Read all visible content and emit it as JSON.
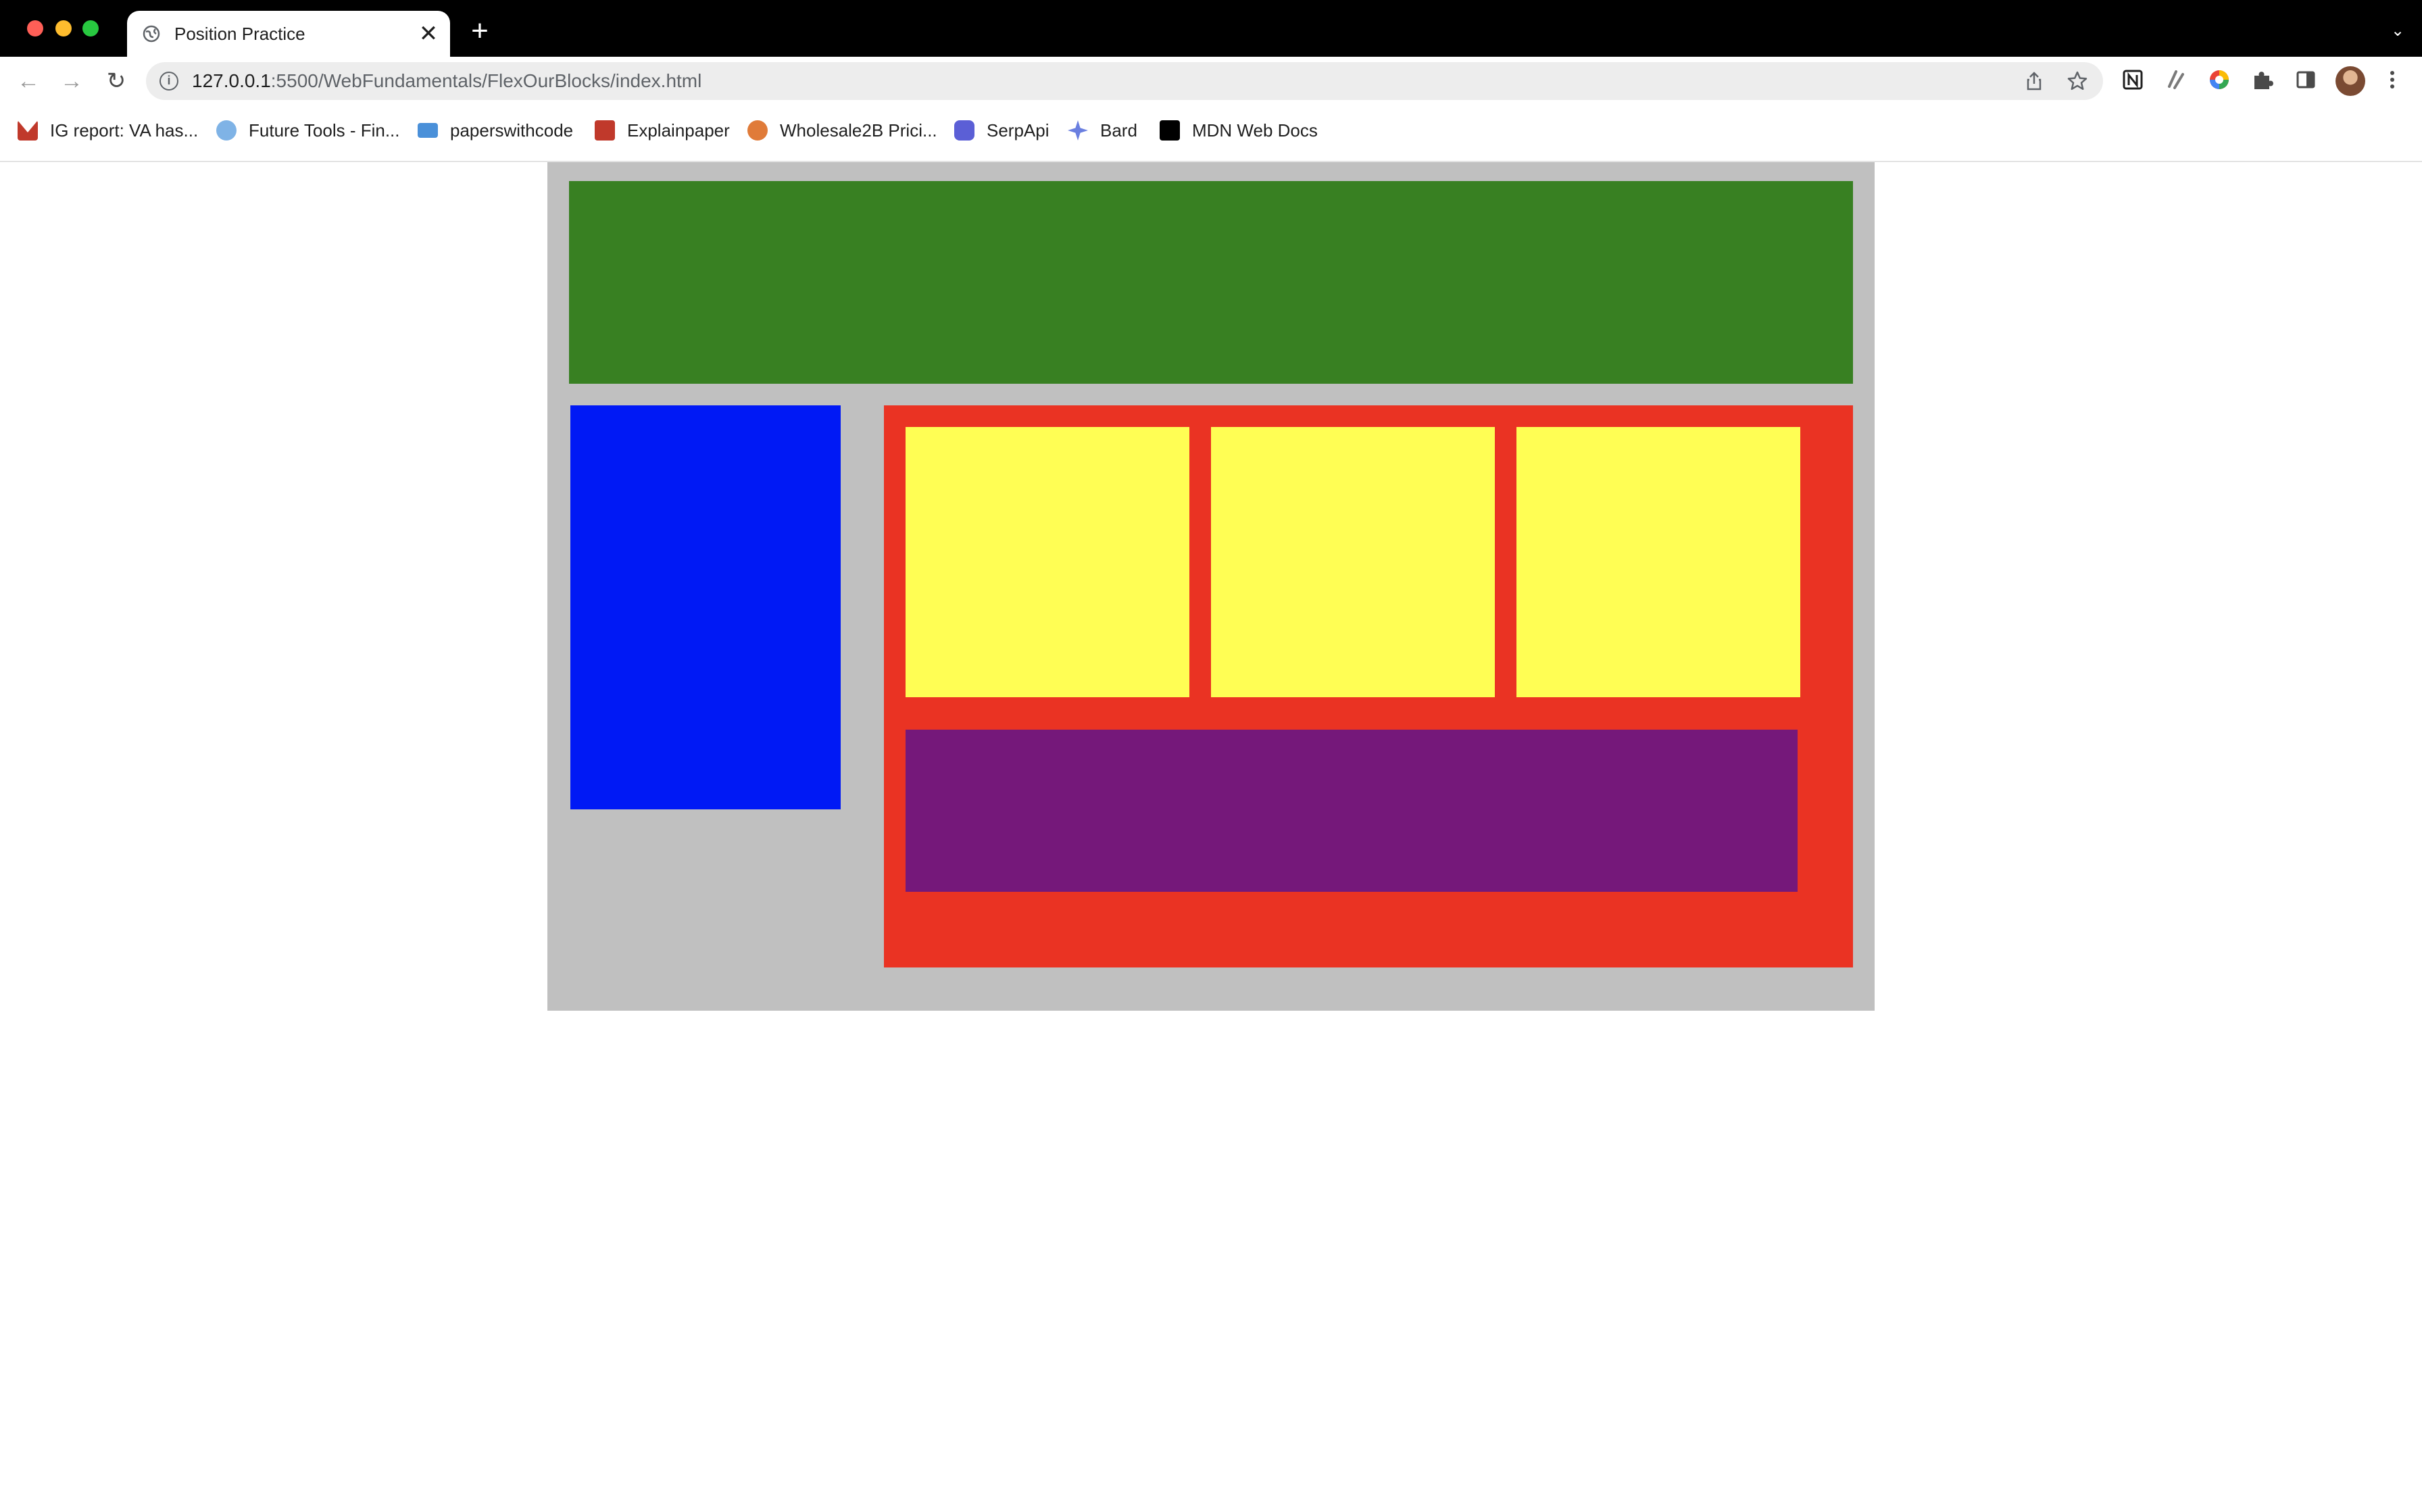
{
  "browser": {
    "tab": {
      "title": "Position Practice",
      "close": "✕"
    },
    "new_tab": "+",
    "tab_list": "⌄",
    "nav": {
      "back": "←",
      "forward": "→",
      "reload": "↻"
    },
    "address": {
      "host": "127.0.0.1",
      "rest": ":5500/WebFundamentals/FlexOurBlocks/index.html"
    },
    "bookmarks": [
      {
        "label": "IG report: VA has...",
        "icon": "ig-report-icon",
        "color": "#c0392b"
      },
      {
        "label": "Future Tools - Fin...",
        "icon": "future-tools-icon",
        "color": "#7fb3e6"
      },
      {
        "label": "paperswithcode",
        "icon": "paperswithcode-icon",
        "color": "#4a90d9"
      },
      {
        "label": "Explainpaper",
        "icon": "explainpaper-icon",
        "color": "#c0392b"
      },
      {
        "label": "Wholesale2B Prici...",
        "icon": "wholesale2b-icon",
        "color": "#e07b39"
      },
      {
        "label": "SerpApi",
        "icon": "serpapi-icon",
        "color": "#5b5fd6"
      },
      {
        "label": "Bard",
        "icon": "bard-icon",
        "color": "#6a7fe0"
      },
      {
        "label": "MDN Web Docs",
        "icon": "mdn-icon",
        "color": "#000000"
      }
    ]
  },
  "page": {
    "colors": {
      "wrapper": "#c0c0c0",
      "header": "#388022",
      "sidebar": "#0019f5",
      "main": "#ea3323",
      "block": "#fffe54",
      "footer": "#75187a"
    }
  }
}
